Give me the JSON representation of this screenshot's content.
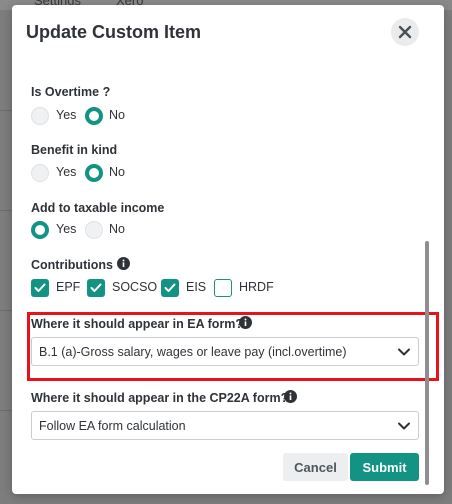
{
  "background": {
    "tabs": [
      "Settings",
      "Xero"
    ]
  },
  "modal": {
    "title": "Update Custom Item",
    "close_icon": "close-icon"
  },
  "form": {
    "is_overtime": {
      "label": "Is Overtime ?",
      "options": [
        "Yes",
        "No"
      ],
      "selected": "No"
    },
    "benefit_in_kind": {
      "label": "Benefit in kind",
      "options": [
        "Yes",
        "No"
      ],
      "selected": "No"
    },
    "add_to_taxable": {
      "label": "Add to taxable income",
      "options": [
        "Yes",
        "No"
      ],
      "selected": "Yes"
    },
    "contributions": {
      "label": "Contributions",
      "items": [
        {
          "label": "EPF",
          "checked": true
        },
        {
          "label": "SOCSO",
          "checked": true
        },
        {
          "label": "EIS",
          "checked": true
        },
        {
          "label": "HRDF",
          "checked": false
        }
      ]
    },
    "ea_form": {
      "label": "Where it should appear in EA form?",
      "value": "B.1 (a)-Gross salary, wages or leave pay (incl.overtime)"
    },
    "cp22a_form": {
      "label": "Where it should appear in the CP22A form?",
      "value": "Follow EA form calculation"
    }
  },
  "actions": {
    "cancel": "Cancel",
    "submit": "Submit"
  },
  "colors": {
    "accent": "#139383",
    "highlight": "#e8121d",
    "overlay": "#7d7d7d"
  }
}
